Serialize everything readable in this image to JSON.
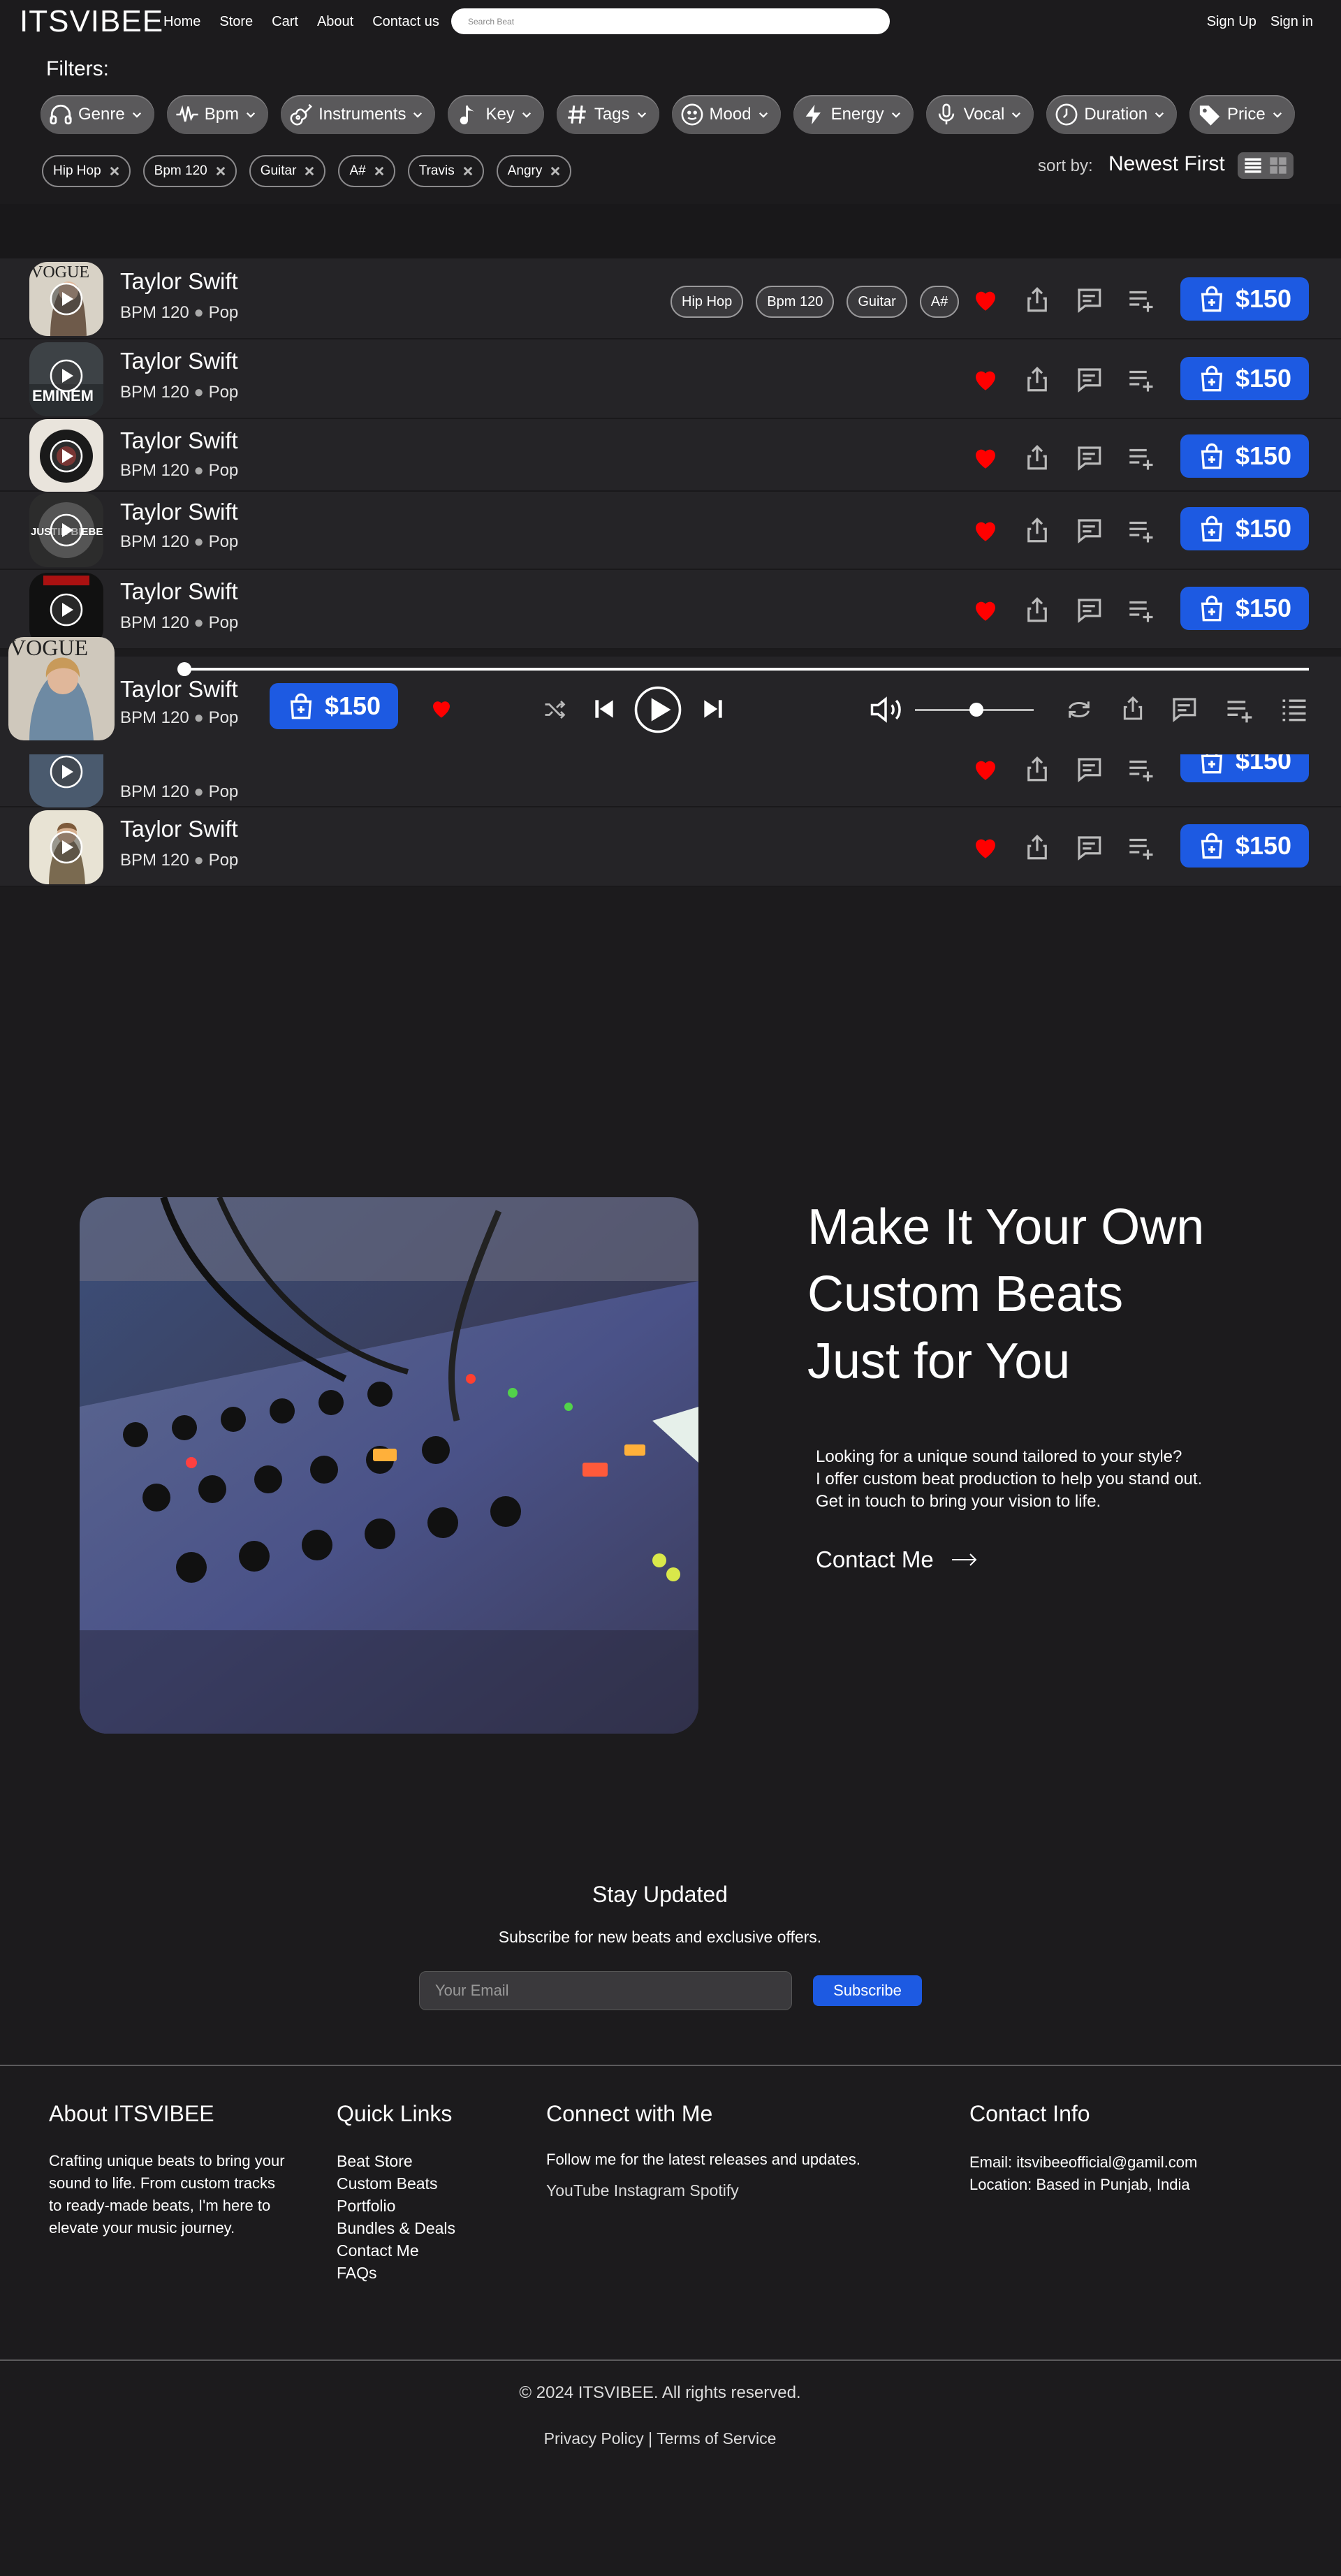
{
  "nav": {
    "logo": "ITSVIBEE",
    "links": [
      "Home",
      "Store",
      "Cart",
      "About",
      "Contact us"
    ],
    "search_placeholder": "Search Beat",
    "sign_up": "Sign Up",
    "sign_in": "Sign in"
  },
  "filters": {
    "title": "Filters:",
    "pills": [
      {
        "label": "Genre",
        "icon": "headphones-icon"
      },
      {
        "label": "Bpm",
        "icon": "pulse-icon"
      },
      {
        "label": "Instruments",
        "icon": "guitar-icon"
      },
      {
        "label": "Key",
        "icon": "music-note-icon"
      },
      {
        "label": "Tags",
        "icon": "hash-icon"
      },
      {
        "label": "Mood",
        "icon": "smile-icon"
      },
      {
        "label": "Energy",
        "icon": "lightning-icon"
      },
      {
        "label": "Vocal",
        "icon": "microphone-icon"
      },
      {
        "label": "Duration",
        "icon": "clock-icon"
      },
      {
        "label": "Price",
        "icon": "price-tag-icon"
      }
    ],
    "active_tags": [
      "Hip Hop",
      "Bpm 120",
      "Guitar",
      "A#",
      "Travis",
      "Angry"
    ],
    "sort_label": "sort by:",
    "sort_value": "Newest First"
  },
  "tracks": [
    {
      "title": "Taylor Swift",
      "bpm": "BPM 120",
      "genre": "Pop",
      "price": "$150",
      "tags": [
        "Hip Hop",
        "Bpm 120",
        "Guitar",
        "A#"
      ]
    },
    {
      "title": "Taylor Swift",
      "bpm": "BPM 120",
      "genre": "Pop",
      "price": "$150",
      "tags": []
    },
    {
      "title": "Taylor Swift",
      "bpm": "BPM 120",
      "genre": "Pop",
      "price": "$150",
      "tags": []
    },
    {
      "title": "Taylor Swift",
      "bpm": "BPM 120",
      "genre": "Pop",
      "price": "$150",
      "tags": []
    },
    {
      "title": "Taylor Swift",
      "bpm": "BPM 120",
      "genre": "Pop",
      "price": "$150",
      "tags": []
    },
    {
      "title": "Taylor Swift",
      "bpm": "BPM 120",
      "genre": "Pop",
      "price": "$150",
      "tags": []
    },
    {
      "title": "Taylor Swift",
      "bpm": "BPM 120",
      "genre": "Pop",
      "price": "$150",
      "tags": []
    }
  ],
  "thumb_texts": {
    "vogue": "VOGUE",
    "eminem": "EMINEM",
    "justin": "JUSTIN BIEBER"
  },
  "player": {
    "title": "Taylor Swift",
    "bpm": "BPM 120",
    "genre": "Pop",
    "price": "$150",
    "progress": 0.0,
    "volume": 0.5
  },
  "custom": {
    "heading": [
      "Make It Your Own",
      "Custom Beats",
      "Just for You"
    ],
    "description": [
      "Looking for a unique sound tailored to your style?",
      "I offer custom beat production to help you stand out.",
      "Get in touch to bring your vision to life."
    ],
    "cta": "Contact Me"
  },
  "newsletter": {
    "title": "Stay Updated",
    "subtitle": "Subscribe for new beats and exclusive offers.",
    "email_placeholder": "Your Email",
    "button": "Subscribe"
  },
  "footer": {
    "about_title": "About ITSVIBEE",
    "about_text": [
      "Crafting unique beats to bring your",
      "sound to life. From custom tracks",
      "to ready-made beats, I'm here to",
      "elevate your music journey."
    ],
    "quick_title": "Quick Links",
    "quick_links": [
      "Beat Store",
      "Custom Beats",
      "Portfolio",
      "Bundles & Deals",
      "Contact Me",
      "FAQs"
    ],
    "connect_title": "Connect with Me",
    "connect_text": "Follow me for the latest releases and updates.",
    "socials": "YouTube Instagram Spotify",
    "contact_title": "Contact Info",
    "email": "Email: itsvibeeofficial@gamil.com",
    "location": "Location: Based in Punjab, India",
    "copyright": "© 2024 ITSVIBEE. All rights reserved.",
    "legal": "Privacy Policy | Terms of Service"
  },
  "colors": {
    "background": "#1c1b1d",
    "row": "#252427",
    "accent": "#1d5ae2",
    "heart": "#ff0000",
    "pill": "#5a595b"
  }
}
